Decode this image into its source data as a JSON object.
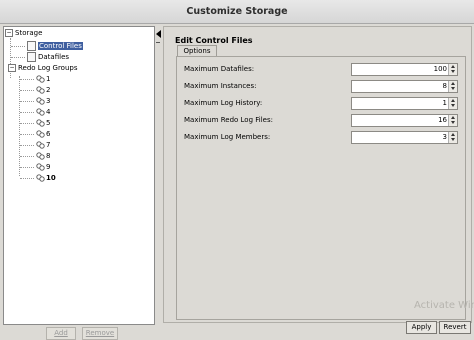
{
  "window": {
    "title": "Customize Storage"
  },
  "tree": {
    "root": "Storage",
    "control_files": "Control Files",
    "datafiles": "Datafiles",
    "redo_log_groups": "Redo Log Groups",
    "groups": [
      "1",
      "2",
      "3",
      "4",
      "5",
      "6",
      "7",
      "8",
      "9",
      "10"
    ]
  },
  "left_buttons": {
    "add": "Add",
    "remove": "Remove"
  },
  "right": {
    "section_title": "Edit Control Files",
    "tab_options": "Options",
    "fields": [
      {
        "label": "Maximum Datafiles:",
        "value": "100"
      },
      {
        "label": "Maximum Instances:",
        "value": "8"
      },
      {
        "label": "Maximum Log History:",
        "value": "1"
      },
      {
        "label": "Maximum Redo Log Files:",
        "value": "16"
      },
      {
        "label": "Maximum Log Members:",
        "value": "3"
      }
    ]
  },
  "buttons": {
    "apply": "Apply",
    "revert": "Revert"
  },
  "watermark": "Activate Win"
}
